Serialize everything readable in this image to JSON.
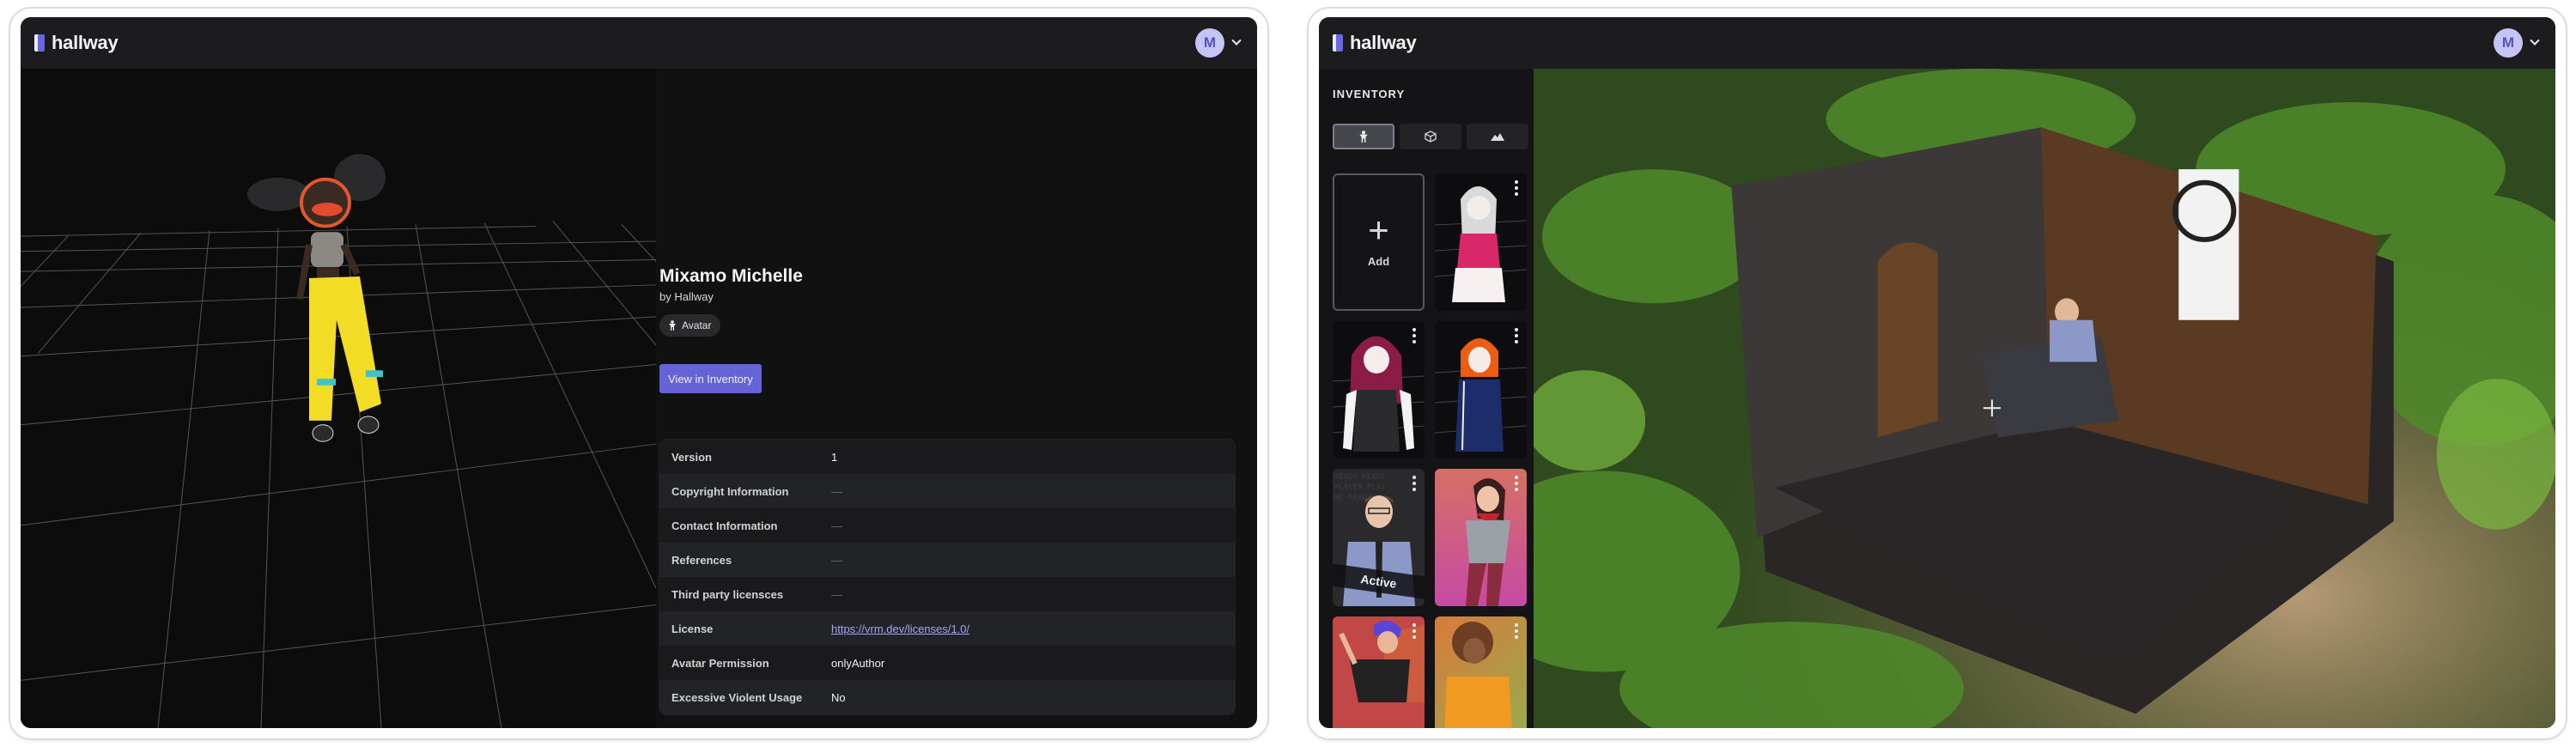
{
  "brand": {
    "name": "hallway",
    "accent": "#6663d6"
  },
  "left_screen": {
    "user_menu": {
      "initial": "M"
    },
    "asset": {
      "title": "Mixamo Michelle",
      "author": "by Hallway",
      "type_chip": {
        "label": "Avatar",
        "icon": "person-icon"
      },
      "view_button_label": "View in Inventory"
    },
    "metadata": [
      {
        "key": "Version",
        "value": "1"
      },
      {
        "key": "Copyright Information",
        "value": "—"
      },
      {
        "key": "Contact Information",
        "value": "—"
      },
      {
        "key": "References",
        "value": "—"
      },
      {
        "key": "Third party licensces",
        "value": "—"
      },
      {
        "key": "License",
        "value": "https://vrm.dev/licenses/1.0/",
        "link": true
      },
      {
        "key": "Avatar Permission",
        "value": "onlyAuthor"
      },
      {
        "key": "Excessive Violent Usage",
        "value": "No"
      }
    ]
  },
  "right_screen": {
    "user_menu": {
      "initial": "M"
    },
    "inventory": {
      "title": "INVENTORY",
      "filters": [
        {
          "name": "avatars",
          "icon": "person-icon",
          "active": true
        },
        {
          "name": "objects",
          "icon": "cube-icon",
          "active": false
        },
        {
          "name": "environments",
          "icon": "mountain-icon",
          "active": false
        }
      ],
      "add_label": "Add",
      "items": [
        {
          "name": "anime-girl-pink",
          "active": false
        },
        {
          "name": "anime-girl-red-hair",
          "active": false
        },
        {
          "name": "anime-girl-tracksuit",
          "active": false
        },
        {
          "name": "man-glasses-tie",
          "active": true,
          "badge": "Active"
        },
        {
          "name": "girl-red-scarf",
          "active": false
        },
        {
          "name": "boy-blue-hair",
          "active": false
        },
        {
          "name": "girl-orange-hoodie",
          "active": false
        }
      ]
    }
  }
}
